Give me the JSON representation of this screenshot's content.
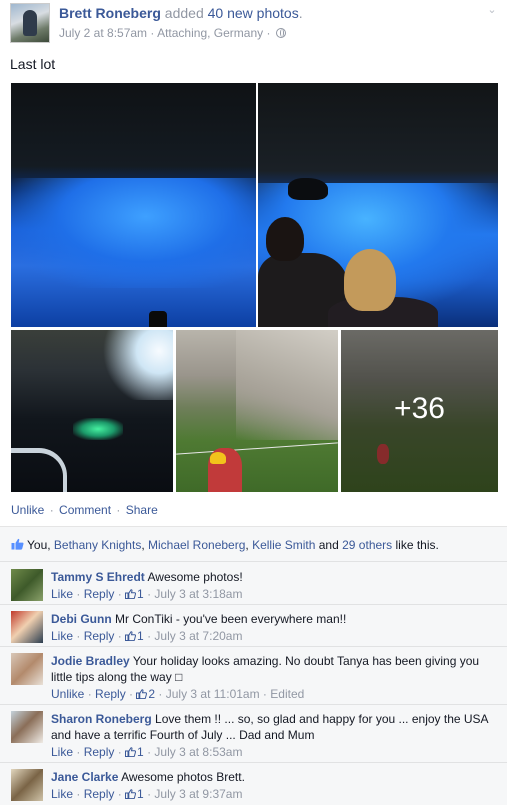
{
  "post": {
    "author": "Brett Roneberg",
    "action_prefix": "added",
    "action_link": "40 new photos",
    "action_suffix": ".",
    "timestamp": "July 2 at 8:57am",
    "location": "Attaching, Germany",
    "privacy_icon": "globe-icon",
    "status": "Last lot",
    "more_photos_overlay": "+36"
  },
  "post_actions": {
    "unlike": "Unlike",
    "comment": "Comment",
    "share": "Share",
    "separator": "·"
  },
  "likes": {
    "prefix": "You, ",
    "person1": "Bethany Knights",
    "person2": "Michael Roneberg",
    "person3": "Kellie Smith",
    "joiner": " and ",
    "others": "29 others",
    "suffix": " like this."
  },
  "comments": [
    {
      "name": "Tammy S Ehredt",
      "text": "Awesome photos!",
      "action": "Like",
      "reply": "Reply",
      "like_count": "1",
      "time": "July 3 at 3:18am",
      "edited": ""
    },
    {
      "name": "Debi Gunn",
      "text": "Mr ConTiki - you've been everywhere man!!",
      "action": "Like",
      "reply": "Reply",
      "like_count": "1",
      "time": "July 3 at 7:20am",
      "edited": ""
    },
    {
      "name": "Jodie Bradley",
      "text": "Your holiday looks amazing. No doubt Tanya has been giving you little tips along the way □",
      "action": "Unlike",
      "reply": "Reply",
      "like_count": "2",
      "time": "July 3 at 11:01am",
      "edited": "Edited"
    },
    {
      "name": "Sharon Roneberg",
      "text": "Love them !! ... so, so glad and happy for you ... enjoy the USA and have a terrific Fourth of July ... Dad and Mum",
      "action": "Like",
      "reply": "Reply",
      "like_count": "1",
      "time": "July 3 at 8:53am",
      "edited": ""
    },
    {
      "name": "Jane Clarke",
      "text": "Awesome photos Brett.",
      "action": "Like",
      "reply": "Reply",
      "like_count": "1",
      "time": "July 3 at 9:37am",
      "edited": ""
    }
  ],
  "colors": {
    "link": "#3b5998",
    "meta": "#9197a3",
    "feedback_bg": "#f6f7f8"
  }
}
